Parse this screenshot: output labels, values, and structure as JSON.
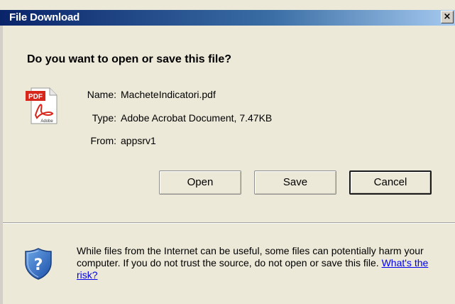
{
  "window": {
    "title": "File Download",
    "close_glyph": "×"
  },
  "question": "Do you want to open or save this file?",
  "file": {
    "icon": "pdf-file-icon",
    "icon_badge": "PDF",
    "icon_caption": "Adobe",
    "name_label": "Name:",
    "name_value": "MacheteIndicatori.pdf",
    "type_label": "Type:",
    "type_value": "Adobe Acrobat Document, 7.47KB",
    "from_label": "From:",
    "from_value": "appsrv1"
  },
  "buttons": {
    "open": "Open",
    "save": "Save",
    "cancel": "Cancel"
  },
  "warning": {
    "icon": "security-shield-icon",
    "icon_glyph": "?",
    "text": "While files from the Internet can be useful, some files can potentially harm your computer. If you do not trust the source, do not open or save this file.",
    "link": "What's the risk?"
  },
  "colors": {
    "dialog_bg": "#ece9d8",
    "titlebar_start": "#0a246a",
    "titlebar_end": "#a6caf0",
    "link": "#0000ee"
  }
}
